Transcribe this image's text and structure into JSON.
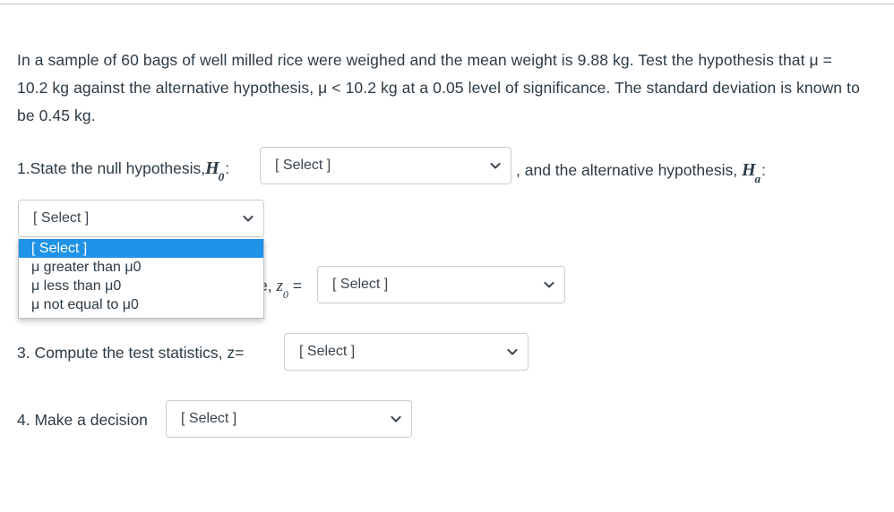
{
  "problem": {
    "text": "In a sample of 60 bags of well milled rice were weighed and the mean weight is 9.88 kg. Test the hypothesis that μ = 10.2 kg against the alternative hypothesis, μ < 10.2 kg at a 0.05 level of significance. The standard deviation is known to be 0.45 kg."
  },
  "questions": {
    "q1": {
      "prefix": "1.State the null hypothesis,",
      "symbol": "H",
      "symbol_sub": "0",
      "colon": ":",
      "tail": ", and the alternative hypothesis, ",
      "tail_symbol": "H",
      "tail_symbol_sub": "a",
      "tail_colon": ":",
      "select_value": "[ Select ]"
    },
    "q2": {
      "label_visible": "e, ",
      "symbol": "z",
      "symbol_sub": "0",
      "equals": " =",
      "select_value": "[ Select ]"
    },
    "q3": {
      "label": "3. Compute the test statistics,  z=",
      "select_value": "[ Select ]"
    },
    "q4": {
      "label": "4. Make a decision",
      "select_value": "[ Select ]"
    }
  },
  "open_dropdown": {
    "field_value": "[ Select ]",
    "options": [
      "[ Select ]",
      "μ greater than μ0",
      "μ less than μ0",
      "μ not equal to μ0"
    ],
    "selected_index": 0,
    "highlight_color": "#1f93e8",
    "highlight_text_color": "#ffffff"
  },
  "icons": {
    "chevron": "chevron-down-icon"
  },
  "colors": {
    "text": "#2d3b45",
    "border": "#c7cdd1",
    "rule": "#c7c7c7",
    "background": "#ffffff"
  }
}
